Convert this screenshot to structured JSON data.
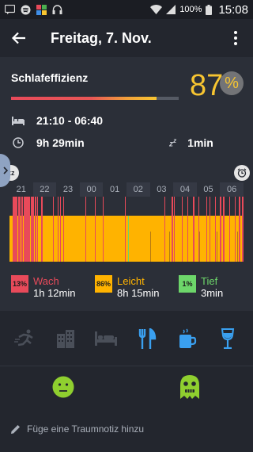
{
  "status": {
    "battery": "100%",
    "time": "15:08",
    "icons": [
      "sms-icon",
      "spotify-icon",
      "gallery-icon",
      "headphones-icon",
      "wifi-icon",
      "signal-icon",
      "battery-icon"
    ]
  },
  "header": {
    "title": "Freitag, 7. Nov."
  },
  "efficiency": {
    "label": "Schlafeffizienz",
    "value": "87",
    "percent_sign": "%",
    "fraction": 0.87,
    "bar_color": "#f7c531"
  },
  "info": {
    "time_range": "21:10 - 06:40",
    "duration": "9h 29min",
    "snooze": "1min"
  },
  "graph": {
    "hours": [
      "21",
      "22",
      "23",
      "00",
      "01",
      "02",
      "03",
      "04",
      "05",
      "06"
    ],
    "start_icon": "zz",
    "colors": {
      "wach": "#e84a5a",
      "leicht": "#ffb300",
      "tief": "#6dd66a"
    }
  },
  "phases": [
    {
      "pct": "13%",
      "name": "Wach",
      "duration": "1h 12min",
      "color": "#e84a5a"
    },
    {
      "pct": "86%",
      "name": "Leicht",
      "duration": "8h 15min",
      "color": "#ffb300"
    },
    {
      "pct": "1%",
      "name": "Tief",
      "duration": "3min",
      "color": "#6dd66a"
    }
  ],
  "activities": [
    "running-icon",
    "buildings-icon",
    "bed-icon",
    "restaurant-icon",
    "coffee-icon",
    "wine-icon"
  ],
  "note": {
    "placeholder": "Füge eine Traumnotiz hinzu"
  }
}
